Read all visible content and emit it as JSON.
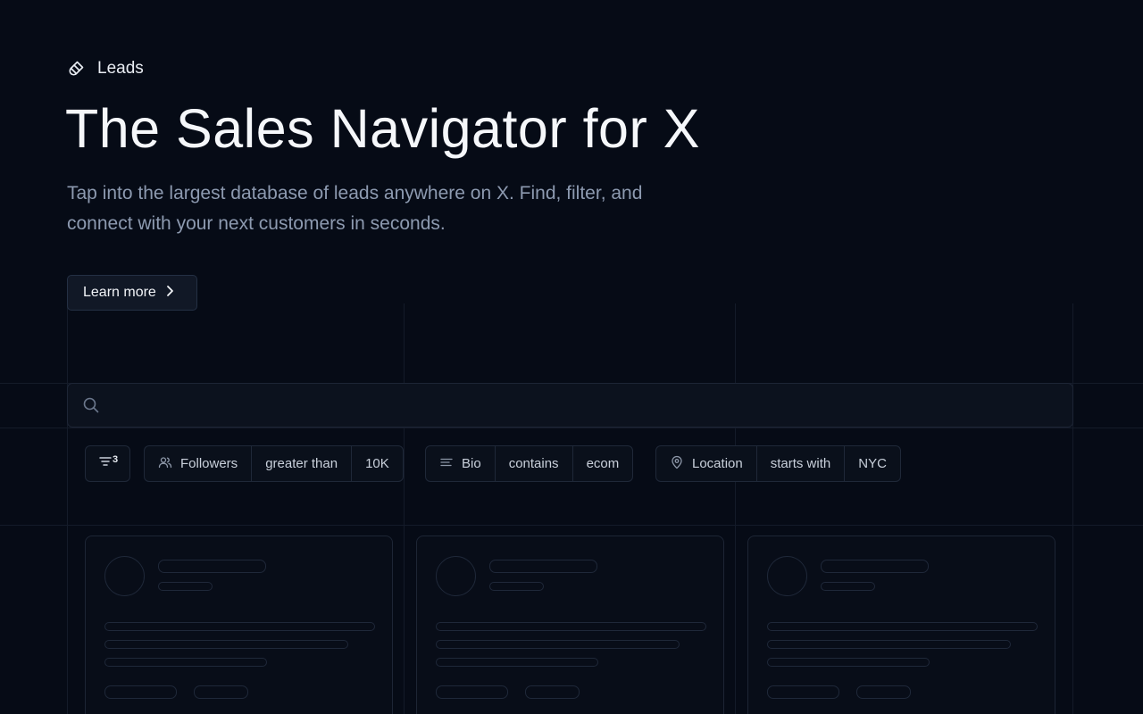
{
  "hero": {
    "eyebrow": "Leads",
    "title": "The Sales Navigator for X",
    "subtitle": "Tap into the largest database of leads anywhere on X. Find, filter, and connect with your next customers in seconds.",
    "cta_label": "Learn more"
  },
  "search": {
    "placeholder": ""
  },
  "filters": {
    "count": "3",
    "items": [
      {
        "icon": "users-icon",
        "field": "Followers",
        "operator": "greater than",
        "value": "10K"
      },
      {
        "icon": "text-lines-icon",
        "field": "Bio",
        "operator": "contains",
        "value": "ecom"
      },
      {
        "icon": "map-pin-icon",
        "field": "Location",
        "operator": "starts with",
        "value": "NYC"
      }
    ]
  },
  "results": {
    "cards": 3,
    "state": "loading-skeleton"
  },
  "colors": {
    "background": "#060b16",
    "text_primary": "#f5f7fa",
    "text_secondary": "#8d9ab0",
    "border": "#1f2838"
  }
}
